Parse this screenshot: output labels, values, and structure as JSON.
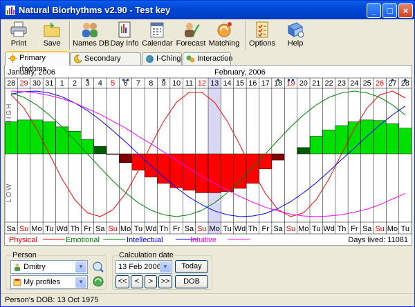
{
  "window": {
    "title": "Natural Biorhythms v2.90 - Test key",
    "min": "_",
    "max": "□",
    "close": "×"
  },
  "toolbar": [
    {
      "name": "print",
      "label": "Print",
      "icon": "printer-icon"
    },
    {
      "name": "save",
      "label": "Save",
      "icon": "folder-icon"
    },
    {
      "name": "names-db",
      "label": "Names DB",
      "icon": "people-icon"
    },
    {
      "name": "day-info",
      "label": "Day Info",
      "icon": "book-icon"
    },
    {
      "name": "calendar",
      "label": "Calendar",
      "icon": "calendar-icon"
    },
    {
      "name": "forecast",
      "label": "Forecast",
      "icon": "forecast-icon"
    },
    {
      "name": "matching",
      "label": "Matching",
      "icon": "matching-icon"
    },
    {
      "name": "options",
      "label": "Options",
      "icon": "checklist-icon"
    },
    {
      "name": "help",
      "label": "Help",
      "icon": "help-icon"
    }
  ],
  "tabs": [
    {
      "label": "Primary rhythms",
      "icon": "sun-icon",
      "active": true
    },
    {
      "label": "Secondary rhythms",
      "icon": "moon-icon",
      "active": false
    },
    {
      "label": "I-Ching",
      "icon": "globe-icon",
      "active": false
    },
    {
      "label": "Interaction",
      "icon": "interaction-icon",
      "active": false
    }
  ],
  "chart": {
    "month_left": "January, 2006",
    "month_right": "February, 2006",
    "high_label": "HIGH",
    "low_label": "LOW",
    "days": [
      "28",
      "29",
      "30",
      "31",
      "1",
      "2",
      "3",
      "4",
      "5",
      "6",
      "7",
      "8",
      "9",
      "10",
      "11",
      "12",
      "13",
      "14",
      "15",
      "16",
      "17",
      "18",
      "19",
      "20",
      "21",
      "22",
      "23",
      "24",
      "25",
      "26",
      "27",
      "28"
    ],
    "weekdays": [
      "Sa",
      "Su",
      "Mo",
      "Tu",
      "Wd",
      "Th",
      "Fr",
      "Sa",
      "Su",
      "Mo",
      "Tu",
      "Wd",
      "Th",
      "Fr",
      "Sa",
      "Su",
      "Mo",
      "Tu",
      "Wd",
      "Th",
      "Fr",
      "Sa",
      "Su",
      "Mo",
      "Tu",
      "Wd",
      "Th",
      "Fr",
      "Sa",
      "Su",
      "Mo",
      "Tu"
    ],
    "markers": [
      0,
      0,
      0,
      0,
      0,
      0,
      1,
      0,
      0,
      2,
      0,
      0,
      1,
      0,
      0,
      0,
      0,
      0,
      0,
      0,
      0,
      1,
      2,
      0,
      0,
      0,
      0,
      0,
      0,
      0,
      1,
      1
    ],
    "selected_index": 16,
    "red_color": "#FF0000",
    "legend": [
      {
        "label": "Physical",
        "color": "#FF0000"
      },
      {
        "label": "Emotional",
        "color": "#008000"
      },
      {
        "label": "Intellectual",
        "color": "#0000FF"
      },
      {
        "label": "Intuitive",
        "color": "#FF00FF"
      }
    ],
    "days_lived": "Days lived: 11081"
  },
  "chart_data": {
    "type": "line",
    "x": [
      "28 Jan",
      "29 Jan",
      "30 Jan",
      "31 Jan",
      "1 Feb",
      "2 Feb",
      "3 Feb",
      "4 Feb",
      "5 Feb",
      "6 Feb",
      "7 Feb",
      "8 Feb",
      "9 Feb",
      "10 Feb",
      "11 Feb",
      "12 Feb",
      "13 Feb",
      "14 Feb",
      "15 Feb",
      "16 Feb",
      "17 Feb",
      "18 Feb",
      "19 Feb",
      "20 Feb",
      "21 Feb",
      "22 Feb",
      "23 Feb",
      "24 Feb",
      "25 Feb",
      "26 Feb",
      "27 Feb",
      "28 Feb"
    ],
    "bars": [
      0.51,
      0.54,
      0.54,
      0.51,
      0.43,
      0.36,
      0.23,
      0.12,
      -0.01,
      -0.14,
      -0.26,
      -0.37,
      -0.47,
      -0.54,
      -0.58,
      -0.62,
      -0.62,
      -0.6,
      -0.55,
      -0.47,
      -0.24,
      -0.1,
      0.0,
      0.1,
      0.28,
      0.38,
      0.45,
      0.51,
      0.54,
      0.53,
      0.48,
      0.41
    ],
    "series": [
      {
        "name": "Physical",
        "period": 23,
        "values": [
          0.94,
          0.73,
          0.4,
          0.0,
          -0.4,
          -0.73,
          -0.94,
          -1.0,
          -0.89,
          -0.63,
          -0.27,
          0.14,
          0.52,
          0.82,
          0.98,
          0.98,
          0.82,
          0.52,
          0.14,
          -0.27,
          -0.63,
          -0.89,
          -1.0,
          -0.94,
          -0.73,
          -0.4,
          0.0,
          0.4,
          0.73,
          0.94,
          1.0,
          0.89
        ]
      },
      {
        "name": "Emotional",
        "period": 28,
        "values": [
          0.97,
          0.9,
          0.78,
          0.62,
          0.43,
          0.22,
          0.0,
          -0.22,
          -0.43,
          -0.62,
          -0.78,
          -0.9,
          -0.97,
          -1.0,
          -0.97,
          -0.9,
          -0.78,
          -0.62,
          -0.43,
          -0.22,
          0.0,
          0.22,
          0.43,
          0.62,
          0.78,
          0.9,
          0.97,
          1.0,
          0.97,
          0.9,
          0.78,
          0.62
        ]
      },
      {
        "name": "Intellectual",
        "period": 33,
        "values": [
          0.95,
          0.99,
          1.0,
          0.97,
          0.91,
          0.81,
          0.69,
          0.54,
          0.37,
          0.19,
          0.0,
          -0.19,
          -0.37,
          -0.54,
          -0.69,
          -0.81,
          -0.91,
          -0.97,
          -1.0,
          -0.99,
          -0.95,
          -0.87,
          -0.76,
          -0.62,
          -0.46,
          -0.28,
          -0.09,
          0.09,
          0.28,
          0.46,
          0.62,
          0.76
        ]
      },
      {
        "name": "Intuitive",
        "period": 38,
        "values": [
          1.0,
          0.99,
          0.97,
          0.93,
          0.88,
          0.81,
          0.72,
          0.63,
          0.52,
          0.41,
          0.28,
          0.16,
          0.03,
          -0.1,
          -0.23,
          -0.36,
          -0.47,
          -0.58,
          -0.68,
          -0.77,
          -0.85,
          -0.91,
          -0.96,
          -0.99,
          -1.0,
          -0.99,
          -0.97,
          -0.93,
          -0.88,
          -0.81,
          -0.72,
          -0.63
        ]
      }
    ],
    "ylim": [
      -1,
      1
    ]
  },
  "person": {
    "group_title": "Person",
    "name": "Dmitry",
    "profile": "My profiles"
  },
  "calc": {
    "group_title": "Calculation date",
    "date": "13 Feb 2006",
    "today": "Today",
    "dob": "DOB",
    "nav": [
      "<<",
      "<",
      ">",
      ">>"
    ]
  },
  "status": {
    "text": "Person's DOB: 13 Oct 1975"
  }
}
